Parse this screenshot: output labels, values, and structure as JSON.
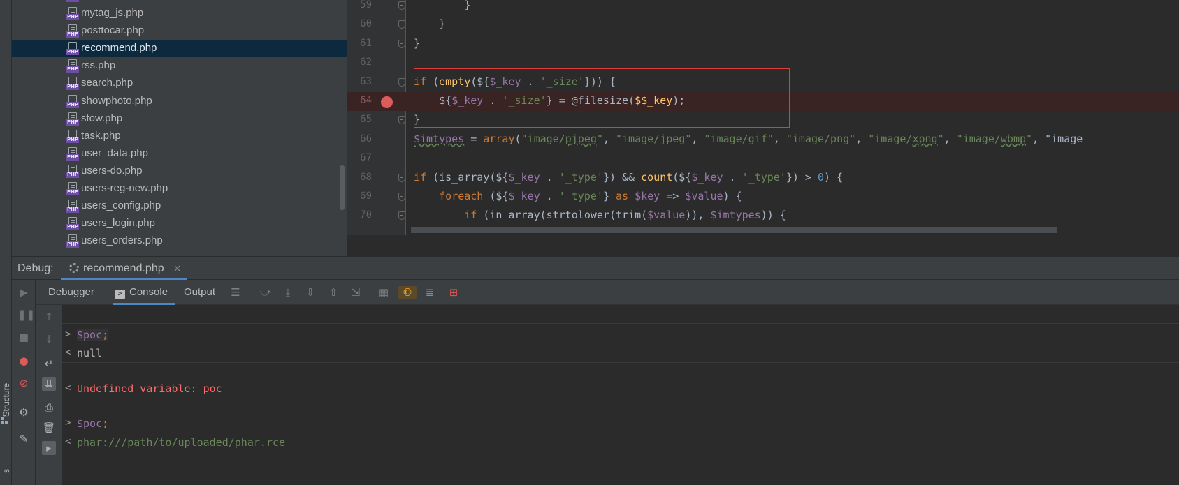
{
  "left_strip": {
    "structure_label": "Structure",
    "bottom_label": "s"
  },
  "project_tree": {
    "files": [
      {
        "name": "mytag_js.php",
        "selected": false
      },
      {
        "name": "posttocar.php",
        "selected": false
      },
      {
        "name": "recommend.php",
        "selected": true
      },
      {
        "name": "rss.php",
        "selected": false
      },
      {
        "name": "search.php",
        "selected": false
      },
      {
        "name": "showphoto.php",
        "selected": false
      },
      {
        "name": "stow.php",
        "selected": false
      },
      {
        "name": "task.php",
        "selected": false
      },
      {
        "name": "user_data.php",
        "selected": false
      },
      {
        "name": "users-do.php",
        "selected": false
      },
      {
        "name": "users-reg-new.php",
        "selected": false
      },
      {
        "name": "users_config.php",
        "selected": false
      },
      {
        "name": "users_login.php",
        "selected": false
      },
      {
        "name": "users_orders.php",
        "selected": false
      }
    ],
    "file_badge": "PHP"
  },
  "editor": {
    "lines": [
      {
        "num": "59",
        "text": "        }"
      },
      {
        "num": "60",
        "text": "    }"
      },
      {
        "num": "61",
        "text": "}"
      },
      {
        "num": "62",
        "text": ""
      },
      {
        "num": "63",
        "text": "if (empty(${$_key . '_size'})) {"
      },
      {
        "num": "64",
        "text": "    ${$_key . '_size'} = @filesize($$_key);"
      },
      {
        "num": "65",
        "text": "}"
      },
      {
        "num": "66",
        "text": "$imtypes = array(\"image/pjpeg\", \"image/jpeg\", \"image/gif\", \"image/png\", \"image/xpng\", \"image/wbmp\", \"image"
      },
      {
        "num": "67",
        "text": ""
      },
      {
        "num": "68",
        "text": "if (is_array(${$_key . '_type'}) && count(${$_key . '_type'}) > 0) {"
      },
      {
        "num": "69",
        "text": "    foreach (${$_key . '_type'} as $key => $value) {"
      },
      {
        "num": "70",
        "text": "        if (in_array(strtolower(trim($value)), $imtypes)) {"
      }
    ]
  },
  "debug": {
    "label": "Debug:",
    "session_tab": "recommend.php",
    "close_glyph": "×",
    "tabs": {
      "debugger": "Debugger",
      "console": "Console",
      "output": "Output"
    },
    "console_glyph": ">"
  },
  "console": {
    "entries": [
      {
        "prompt": ">",
        "text": "$poc",
        "semi": ";",
        "kind": "in"
      },
      {
        "prompt": "<",
        "text": "null",
        "kind": "null"
      },
      {
        "prompt": "<",
        "text": "Undefined variable: poc",
        "kind": "err"
      },
      {
        "prompt": ">",
        "text": "$poc",
        "semi": ";",
        "kind": "in"
      },
      {
        "prompt": "<",
        "text": "phar:///path/to/uploaded/phar.rce",
        "kind": "ok"
      }
    ]
  },
  "colors": {
    "accent": "#4a88c7",
    "selection": "#0d293e",
    "breakpoint": "#db5c5c",
    "highlight_box": "#e03c3c",
    "error_text": "#ff6b68",
    "string_green": "#6a8759",
    "keyword_orange": "#cc7832",
    "variable_purple": "#9876aa"
  }
}
